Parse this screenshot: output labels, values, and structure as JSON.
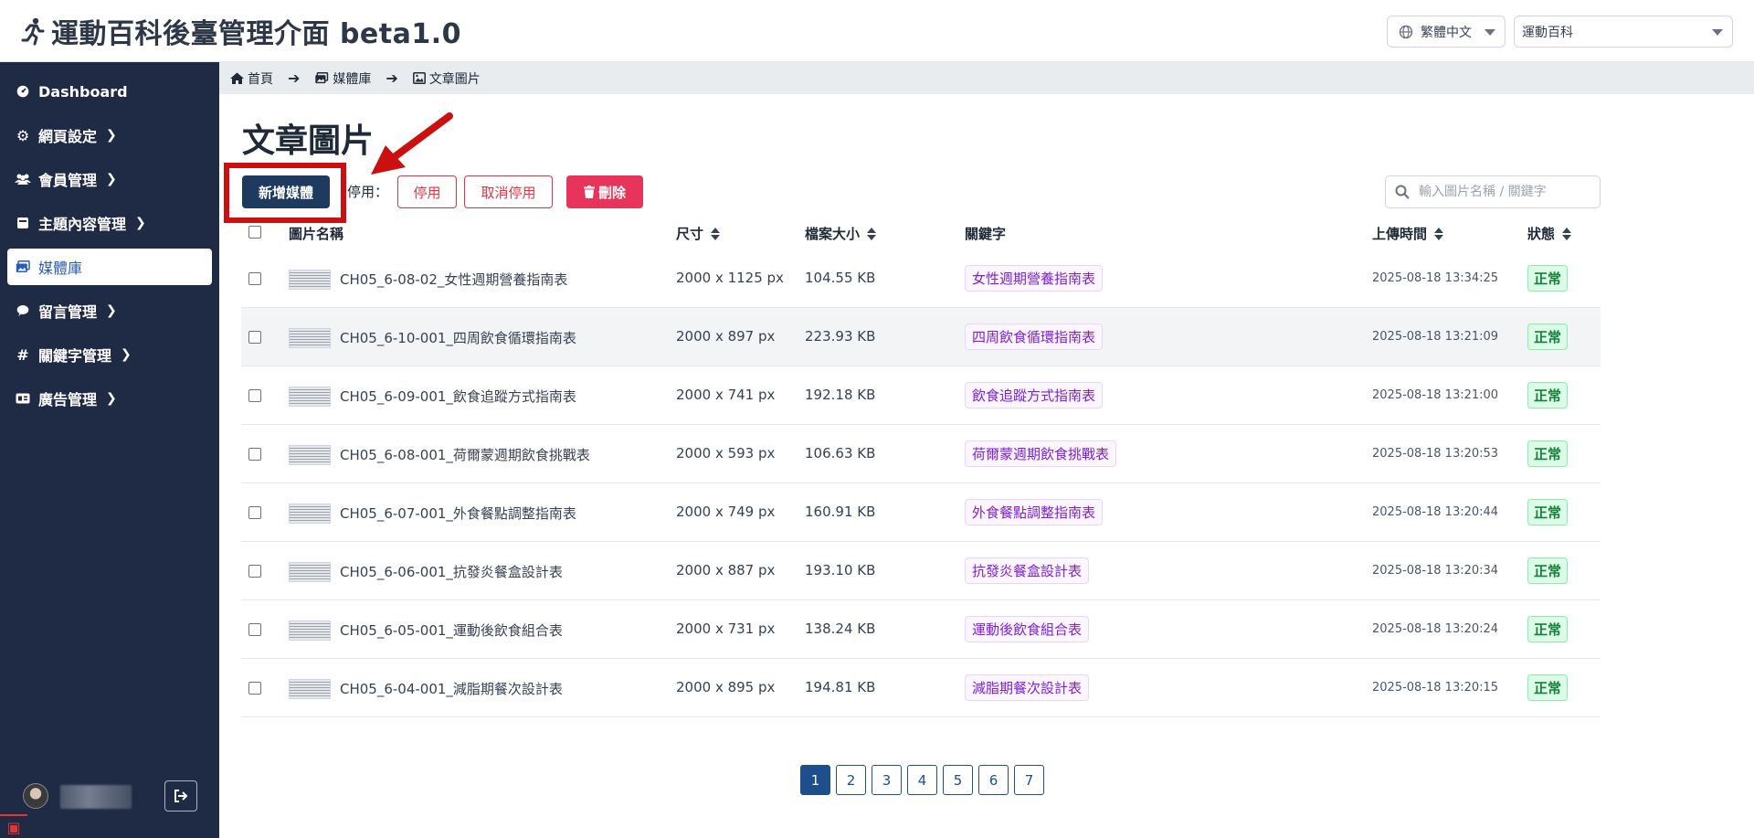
{
  "header": {
    "title": "運動百科後臺管理介面 beta1.0",
    "language": "繁體中文",
    "site": "運動百科"
  },
  "sidebar": {
    "items": [
      {
        "label": "Dashboard",
        "icon": "dashboard-icon"
      },
      {
        "label": "網頁設定",
        "icon": "gear-icon"
      },
      {
        "label": "會員管理",
        "icon": "users-icon"
      },
      {
        "label": "主題內容管理",
        "icon": "book-icon"
      },
      {
        "label": "媒體庫",
        "icon": "images-icon"
      },
      {
        "label": "留言管理",
        "icon": "comment-icon"
      },
      {
        "label": "關鍵字管理",
        "icon": "hashtag-icon"
      },
      {
        "label": "廣告管理",
        "icon": "ad-icon"
      }
    ],
    "active_index": 4
  },
  "breadcrumb": [
    "首頁",
    "媒體庫",
    "文章圖片"
  ],
  "main": {
    "title": "文章圖片",
    "add_button": "新增媒體",
    "disable_label": "停用：",
    "disable_button": "停用",
    "undisable_button": "取消停用",
    "delete_button": "刪除",
    "search_placeholder": "輸入圖片名稱 / 關鍵字"
  },
  "table": {
    "headers": {
      "name": "圖片名稱",
      "size": "尺寸",
      "filesize": "檔案大小",
      "keyword": "關鍵字",
      "uploaded": "上傳時間",
      "status": "狀態"
    },
    "rows": [
      {
        "name": "CH05_6-08-02_女性週期營養指南表",
        "size": "2000 x 1125 px",
        "filesize": "104.55 KB",
        "keyword": "女性週期營養指南表",
        "uploaded": "2025-08-18 13:34:25",
        "status": "正常"
      },
      {
        "name": "CH05_6-10-001_四周飲食循環指南表",
        "size": "2000 x 897 px",
        "filesize": "223.93 KB",
        "keyword": "四周飲食循環指南表",
        "uploaded": "2025-08-18 13:21:09",
        "status": "正常"
      },
      {
        "name": "CH05_6-09-001_飲食追蹤方式指南表",
        "size": "2000 x 741 px",
        "filesize": "192.18 KB",
        "keyword": "飲食追蹤方式指南表",
        "uploaded": "2025-08-18 13:21:00",
        "status": "正常"
      },
      {
        "name": "CH05_6-08-001_荷爾蒙週期飲食挑戰表",
        "size": "2000 x 593 px",
        "filesize": "106.63 KB",
        "keyword": "荷爾蒙週期飲食挑戰表",
        "uploaded": "2025-08-18 13:20:53",
        "status": "正常"
      },
      {
        "name": "CH05_6-07-001_外食餐點調整指南表",
        "size": "2000 x 749 px",
        "filesize": "160.91 KB",
        "keyword": "外食餐點調整指南表",
        "uploaded": "2025-08-18 13:20:44",
        "status": "正常"
      },
      {
        "name": "CH05_6-06-001_抗發炎餐盒設計表",
        "size": "2000 x 887 px",
        "filesize": "193.10 KB",
        "keyword": "抗發炎餐盒設計表",
        "uploaded": "2025-08-18 13:20:34",
        "status": "正常"
      },
      {
        "name": "CH05_6-05-001_運動後飲食組合表",
        "size": "2000 x 731 px",
        "filesize": "138.24 KB",
        "keyword": "運動後飲食組合表",
        "uploaded": "2025-08-18 13:20:24",
        "status": "正常"
      },
      {
        "name": "CH05_6-04-001_減脂期餐次設計表",
        "size": "2000 x 895 px",
        "filesize": "194.81 KB",
        "keyword": "減脂期餐次設計表",
        "uploaded": "2025-08-18 13:20:15",
        "status": "正常"
      }
    ]
  },
  "pagination": {
    "pages": [
      "1",
      "2",
      "3",
      "4",
      "5",
      "6",
      "7"
    ],
    "current": "1"
  },
  "colors": {
    "sidebar_bg": "#1f2a44",
    "primary": "#1f3a5f",
    "danger": "#dc3545",
    "delete": "#e8345a",
    "highlight": "#cc0f0f",
    "status_ok": "#15803d"
  }
}
